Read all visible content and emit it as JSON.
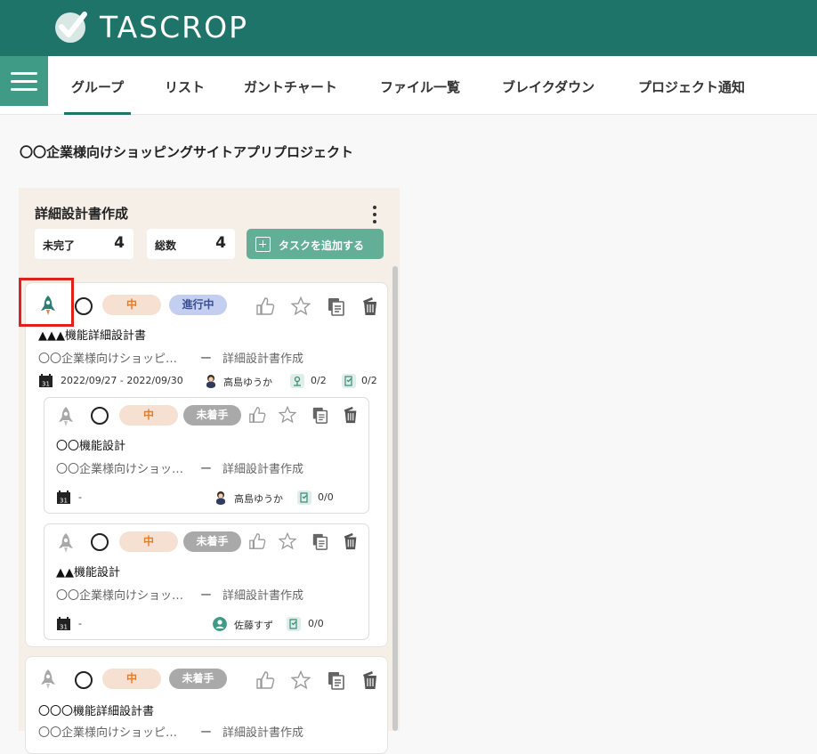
{
  "app": {
    "logo_text": "TASCROP",
    "brand_color": "#1e7468",
    "accent_color": "#62ae96"
  },
  "nav": {
    "tabs": [
      {
        "label": "グループ",
        "active": true
      },
      {
        "label": "リスト"
      },
      {
        "label": "ガントチャート"
      },
      {
        "label": "ファイル一覧"
      },
      {
        "label": "ブレイクダウン"
      },
      {
        "label": "プロジェクト通知"
      }
    ]
  },
  "project": {
    "title": "〇〇企業様向けショッピングサイトアプリプロジェクト"
  },
  "group": {
    "title": "詳細設計書作成",
    "incomplete_label": "未完了",
    "incomplete_count": "4",
    "total_label": "総数",
    "total_count": "4",
    "add_task_label": "タスクを追加する"
  },
  "tasks": [
    {
      "priority": "中",
      "status": "進行中",
      "name": "▲▲▲機能詳細設計書",
      "project": "〇〇企業様向けショッピ…",
      "dash": "ー",
      "group": "詳細設計書作成",
      "date": "2022/09/27 - 2022/09/30",
      "assignee": "高島ゆうか",
      "subtasks": "0/2",
      "checklist": "0/2"
    },
    {
      "priority": "中",
      "status": "未着手",
      "name": "〇〇機能設計",
      "project": "〇〇企業様向けショッ…",
      "dash": "ー",
      "group": "詳細設計書作成",
      "date": "-",
      "assignee": "高島ゆうか",
      "checklist": "0/0"
    },
    {
      "priority": "中",
      "status": "未着手",
      "name": "▲▲機能設計",
      "project": "〇〇企業様向けショッ…",
      "dash": "ー",
      "group": "詳細設計書作成",
      "date": "-",
      "assignee": "佐藤すず",
      "checklist": "0/0"
    },
    {
      "priority": "中",
      "status": "未着手",
      "name": "〇〇〇機能詳細設計書",
      "project": "〇〇企業様向けショッピ…",
      "dash": "ー",
      "group": "詳細設計書作成"
    }
  ]
}
